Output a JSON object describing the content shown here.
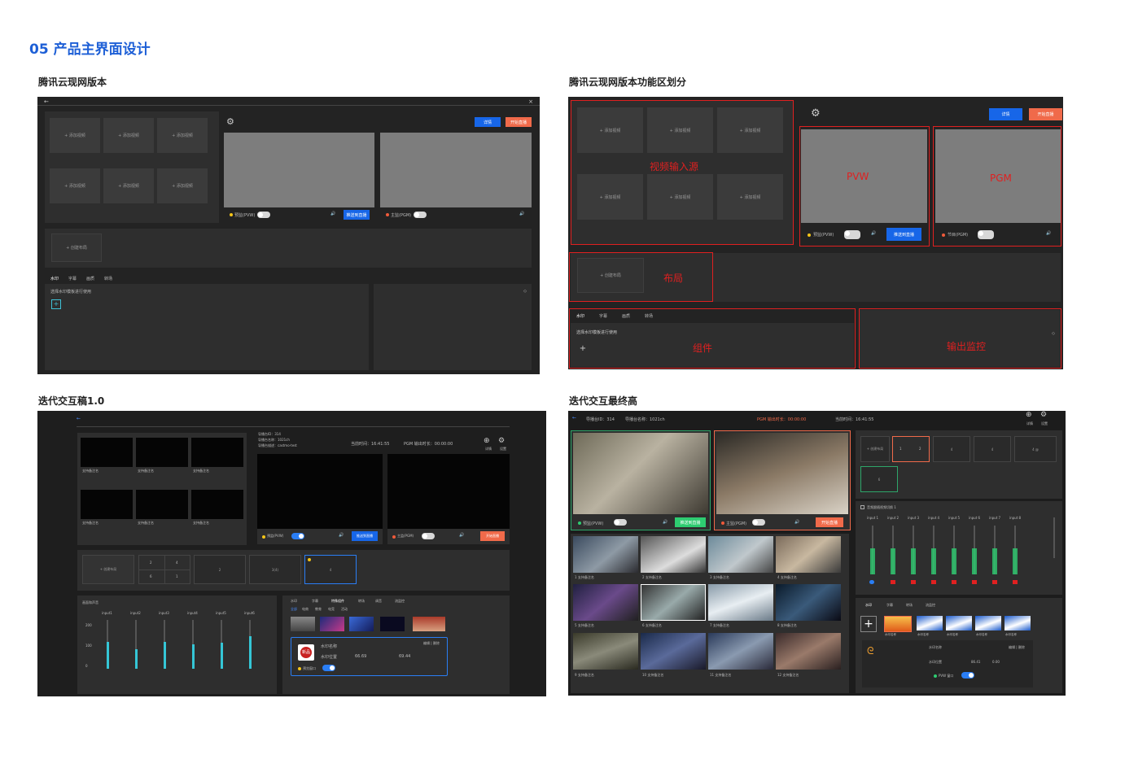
{
  "page_title": "05 产品主界面设计",
  "captions": {
    "s1": "腾讯云现网版本",
    "s2": "腾讯云现网版本功能区划分",
    "s3": "迭代交互稿1.0",
    "s4": "迭代交互最终高"
  },
  "s1": {
    "add_video": "+ 添加视频",
    "create_layout": "+ 创建布局",
    "btn_detail": "详情",
    "btn_start": "开始直播",
    "pvw_label": "预监(PVW)",
    "pgm_label": "主监(PGM)",
    "push_btn": "推送到直播",
    "tabs": [
      "水印",
      "字幕",
      "画质",
      "转场"
    ],
    "hint": "选择水印模板进行使用"
  },
  "s2": {
    "add_video": "+ 添加视频",
    "create_layout": "+ 创建布局",
    "btn_detail": "详情",
    "btn_start": "开始直播",
    "pvw_label": "预监(PVW)",
    "pgm_label": "节目(PGM)",
    "push_btn": "推送到直播",
    "tabs": [
      "水印",
      "字幕",
      "画质",
      "转场"
    ],
    "hint": "选择水印模板进行使用",
    "regions": {
      "input": "视频输入源",
      "pvw": "PVW",
      "pgm": "PGM",
      "layout": "布局",
      "component": "组件",
      "monitor": "输出监控"
    }
  },
  "s3": {
    "info": [
      "导播台ID：314",
      "导播台名称：1021ch",
      "导播台描述：castmo-test"
    ],
    "time": "当前时间：16:41:55",
    "pgm_dur": "PGM 输出时长：00:00:00",
    "icon_labels": [
      "详情",
      "设置"
    ],
    "source_name": "支持备注名",
    "pvw_label": "预监(PVW)",
    "pgm_label": "主监(PGM)",
    "push_btn": "推送到直播",
    "start_btn": "开始直播",
    "create_layout": "+ 创建布局",
    "layout_nums": [
      "2",
      "4",
      "6",
      "1",
      "2",
      "3(4)",
      "4"
    ],
    "mixer_title": "画面和声音",
    "inputs": [
      "input1",
      "input2",
      "input3",
      "input4",
      "input5",
      "input6"
    ],
    "scale": [
      "200",
      "100",
      "0"
    ],
    "tabs": [
      "水印",
      "字幕",
      "特殊组件",
      "转场",
      "调音",
      "流监控"
    ],
    "subtabs": [
      "全部",
      "电商",
      "教育",
      "电竞",
      "活动"
    ],
    "wm_name_lbl": "水印名称",
    "wm_pos_lbl": "水印位置",
    "wm_x": "66.69",
    "wm_y": "69.44",
    "edit_del": "编辑 | 删除",
    "preview_window": "预览窗口",
    "badge": "新品"
  },
  "s4": {
    "station_id": "导播台ID：314",
    "station_name": "导播台名称：1021ch",
    "pgm_dur": "PGM 输出时长：00:00:00",
    "time": "当前时间：16:41:55",
    "icon_labels": [
      "详情",
      "设置"
    ],
    "pvw_label": "预监(PVW)",
    "pgm_label": "主监(PGM)",
    "push_btn": "推送到直播",
    "start_btn": "开始直播",
    "sources": [
      "1 支持备注名",
      "2 支持备注名",
      "3 支持备注名",
      "4 支持备注名",
      "5 支持备注名",
      "6 支持备注名",
      "7 支持备注名",
      "8 支持备注名",
      "9 支持备注名",
      "10 支持备注名",
      "11 支持备注名",
      "12 支持备注名"
    ],
    "create_layout": "+ 创建布局",
    "layout_nums": [
      "1",
      "2",
      "4",
      "2",
      "1",
      "4",
      "4",
      "4",
      "6",
      "6",
      "4 @"
    ],
    "audio_check": "音频跟随视频切换 1",
    "inputs": [
      "input 1",
      "input 2",
      "input 3",
      "input 4",
      "input 5",
      "input 6",
      "input 7",
      "input 8"
    ],
    "tabs": [
      "水印",
      "字幕",
      "转场",
      "流监控"
    ],
    "wm_names": [
      "水印名称",
      "水印名称",
      "水印名称",
      "水印名称",
      "水印名称"
    ],
    "wm_name_lbl": "水印名称",
    "wm_pos_lbl": "水印位置",
    "wm_x": "86.41",
    "wm_y": "0.00",
    "edit_del": "编辑 | 删除",
    "pvw_window": "PVW 窗口"
  }
}
